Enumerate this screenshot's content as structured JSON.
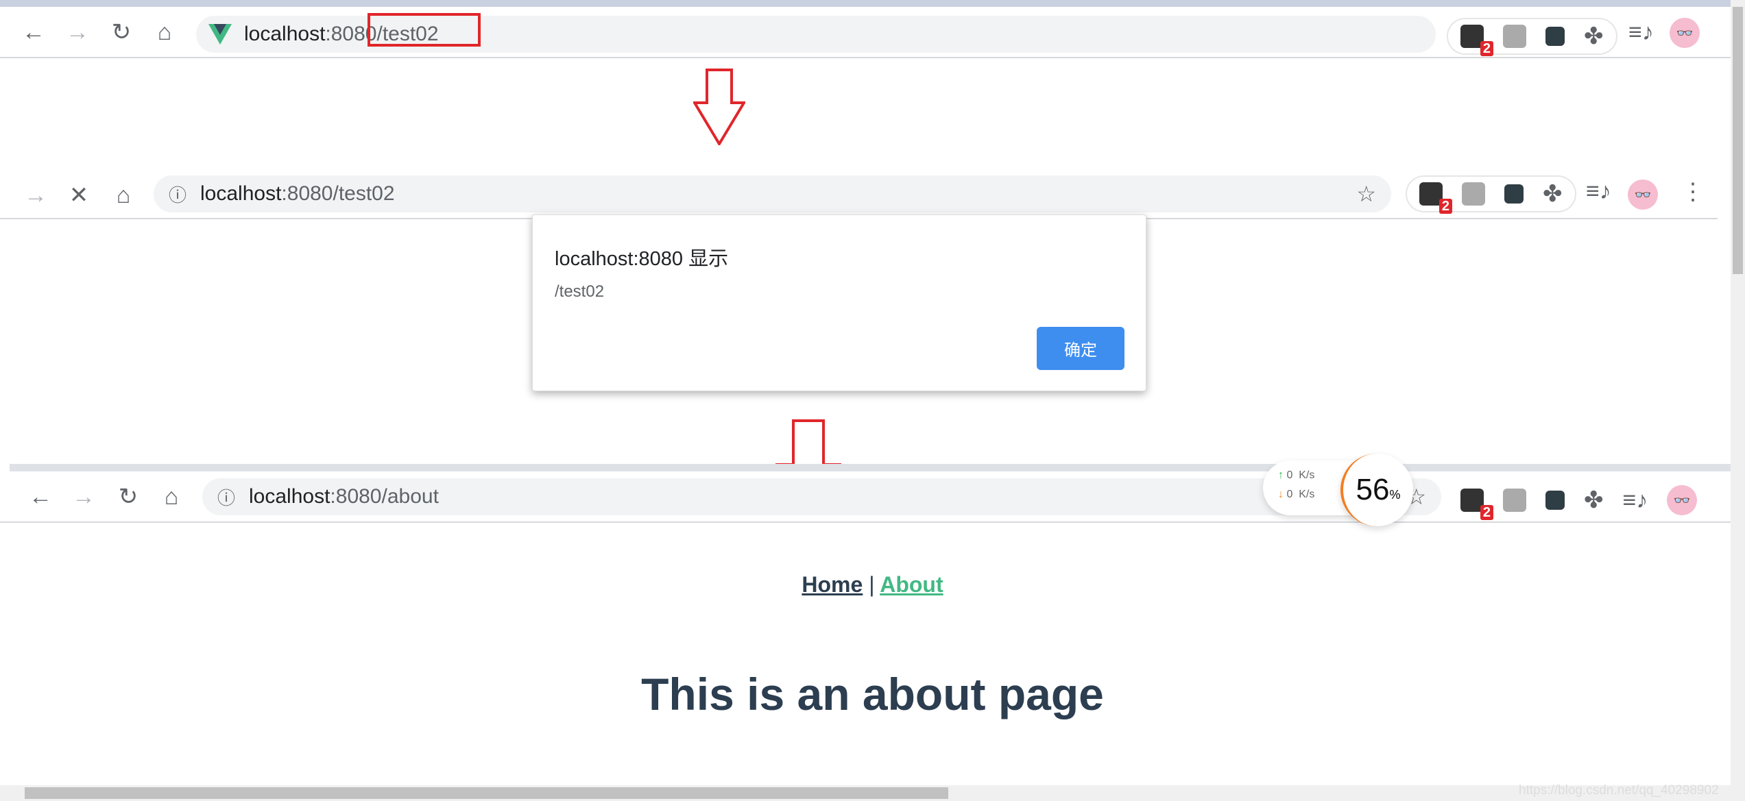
{
  "step1": {
    "url_host": "localhost",
    "url_rest": ":8080/test02",
    "site_icon": "vue-logo-icon",
    "badge_count": "2"
  },
  "step2": {
    "url_host": "localhost",
    "url_rest": ":8080/test02",
    "badge_count": "2"
  },
  "dialog": {
    "title": "localhost:8080 显示",
    "message": "/test02",
    "ok_label": "确定"
  },
  "step3": {
    "url_host": "localhost",
    "url_rest": ":8080/about",
    "badge_count": "2",
    "net_up": "0",
    "net_down": "0",
    "net_unit": "K/s",
    "cpu_value": "56",
    "cpu_unit": "%"
  },
  "page": {
    "nav_home": "Home",
    "nav_separator": "|",
    "nav_about": "About",
    "heading": "This is an about page"
  },
  "watermark": "https://blog.csdn.net/qq_40298902",
  "colors": {
    "annotation_red": "#e0262b",
    "link_green": "#42b983",
    "text_dark": "#2c3e50",
    "button_blue": "#3e8ef0"
  }
}
